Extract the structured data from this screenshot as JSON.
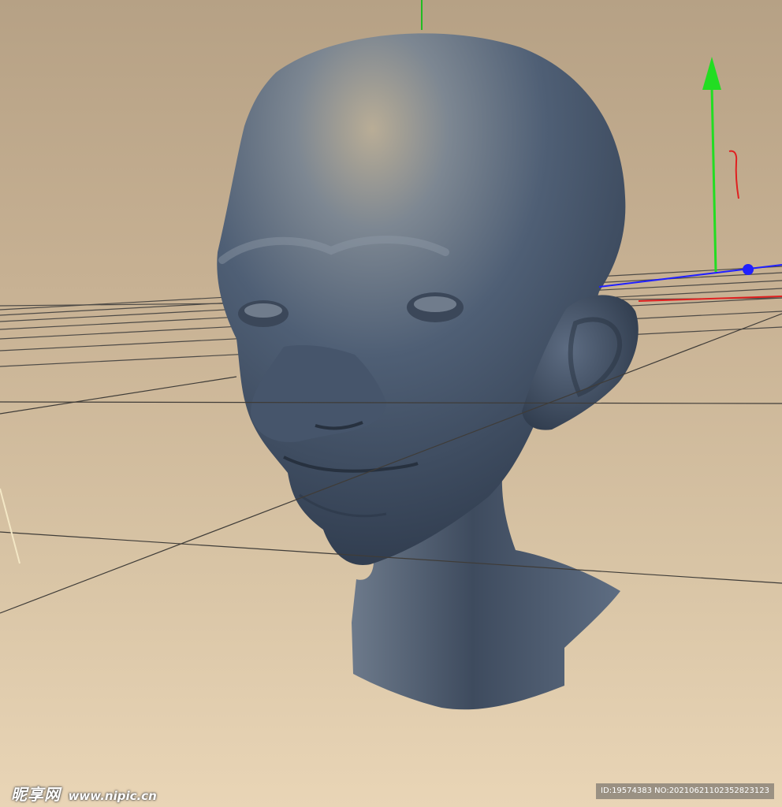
{
  "viewport": {
    "type": "3D sculpt viewport",
    "object": "head bust",
    "background_gradient": [
      "#b6a185",
      "#e9d5b6"
    ],
    "mesh_color": "#4a5a70",
    "grid_color": "#4d4a46",
    "axis_colors": {
      "x": "#e02020",
      "y": "#22dd22",
      "z": "#2020ff"
    }
  },
  "watermark": {
    "brand": "昵享网",
    "url": "www.nipic.cn"
  },
  "image_id": {
    "text": "ID:19574383 NO:20210621102352823123"
  }
}
